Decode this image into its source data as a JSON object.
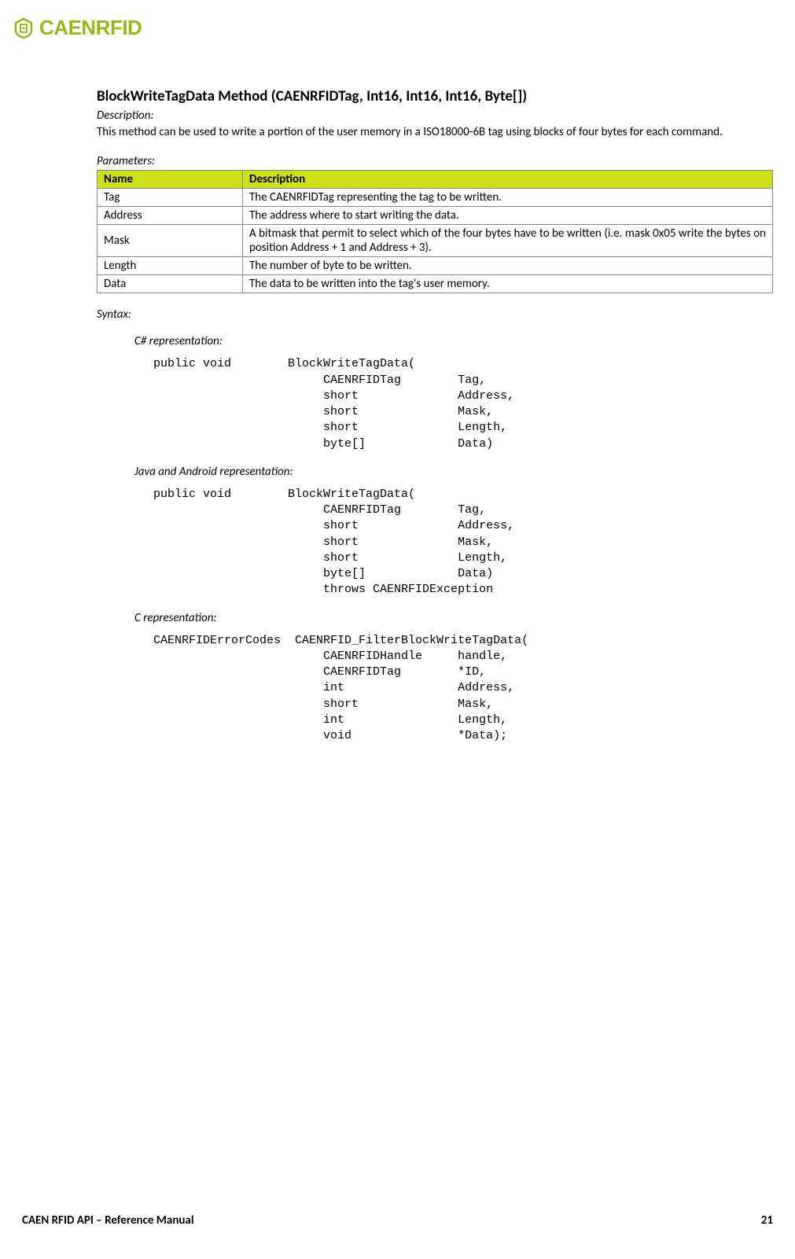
{
  "brand": {
    "name": "CAENRFID"
  },
  "method": {
    "title": "BlockWriteTagData Method (CAENRFIDTag, Int16, Int16, Int16, Byte[])",
    "descriptionLabel": "Description:",
    "descriptionText": "This method can be used to write a portion of the user memory in a ISO18000-6B tag using blocks of four bytes for each command."
  },
  "parametersLabel": "Parameters:",
  "paramsHeader": {
    "name": "Name",
    "description": "Description"
  },
  "params": [
    {
      "name": "Tag",
      "desc": "The CAENRFIDTag representing the tag to be written."
    },
    {
      "name": "Address",
      "desc": "The address where to start writing the data."
    },
    {
      "name": "Mask",
      "desc": "A bitmask that permit to select which of the four bytes have to be written (i.e. mask 0x05 write the bytes on position Address + 1 and Address + 3)."
    },
    {
      "name": "Length",
      "desc": "The number of byte to be written."
    },
    {
      "name": "Data",
      "desc": "The data to be written into the tag's user memory."
    }
  ],
  "syntaxLabel": "Syntax:",
  "representations": {
    "csharp": {
      "label": "C# representation:",
      "code": "public void        BlockWriteTagData(\n                        CAENRFIDTag        Tag,\n                        short              Address,\n                        short              Mask,\n                        short              Length,\n                        byte[]             Data)"
    },
    "java": {
      "label": "Java and Android representation:",
      "code": "public void        BlockWriteTagData(\n                        CAENRFIDTag        Tag,\n                        short              Address,\n                        short              Mask,\n                        short              Length,\n                        byte[]             Data)\n                        throws CAENRFIDException"
    },
    "c": {
      "label": "C representation:",
      "code": "CAENRFIDErrorCodes  CAENRFID_FilterBlockWriteTagData(\n                        CAENRFIDHandle     handle,\n                        CAENRFIDTag        *ID,\n                        int                Address,\n                        short              Mask,\n                        int                Length,\n                        void               *Data);"
    }
  },
  "footer": {
    "left": "CAEN RFID API – Reference Manual",
    "right": "21"
  }
}
